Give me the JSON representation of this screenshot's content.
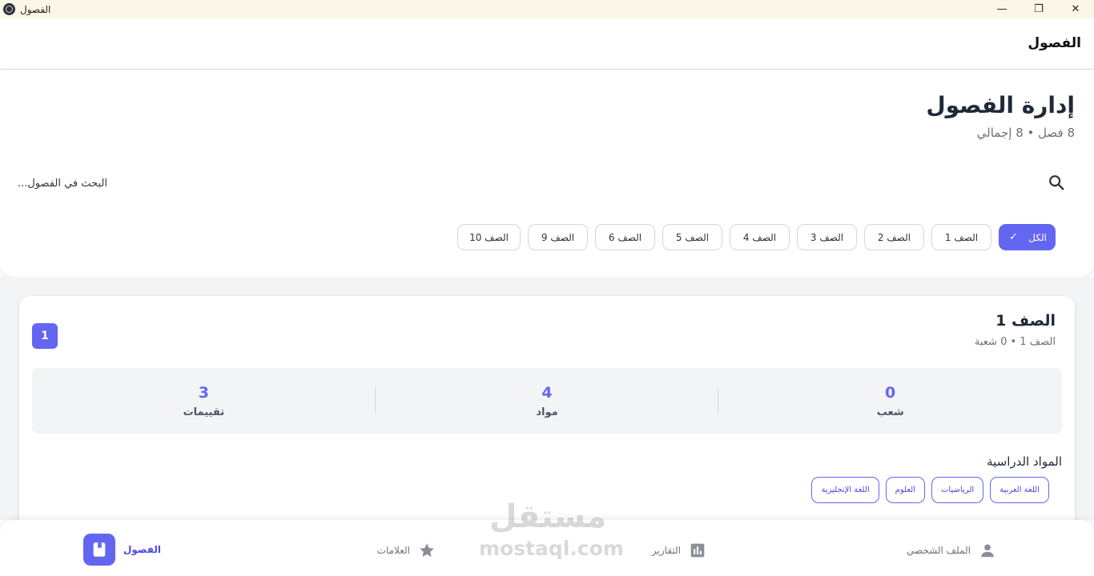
{
  "window": {
    "title": "الفصول",
    "controls": {
      "minimize": "—",
      "restore": "❐",
      "close": "✕"
    }
  },
  "appbar": {
    "title": "الفصول"
  },
  "header": {
    "title": "إدارة الفصول",
    "subtitle": "8 فصل • 8 إجمالي"
  },
  "search": {
    "placeholder": "البحث في الفصول..."
  },
  "filters": {
    "all": {
      "label": "الكل",
      "check": "✓"
    },
    "grades": [
      {
        "label": "الصف 1"
      },
      {
        "label": "الصف 2"
      },
      {
        "label": "الصف 3"
      },
      {
        "label": "الصف 4"
      },
      {
        "label": "الصف 5"
      },
      {
        "label": "الصف 6"
      },
      {
        "label": "الصف 9"
      },
      {
        "label": "الصف 10"
      }
    ]
  },
  "grade_card": {
    "title": "الصف 1",
    "subtitle": "الصف 1 • 0 شعبة",
    "badge": "1",
    "stats": [
      {
        "value": "0",
        "label": "شعب"
      },
      {
        "value": "4",
        "label": "مواد"
      },
      {
        "value": "3",
        "label": "تقييمات"
      }
    ],
    "subjects_title": "المواد الدراسية",
    "subjects": [
      {
        "label": "اللغة العربية"
      },
      {
        "label": "الرياضيات"
      },
      {
        "label": "العلوم"
      },
      {
        "label": "اللغة الإنجليزية"
      }
    ]
  },
  "watermark": {
    "arabic": "مستقل",
    "latin": "mostaql.com"
  },
  "bottom_nav": {
    "items": [
      {
        "label": "الملف الشخصي",
        "icon": "person-icon"
      },
      {
        "label": "التقارير",
        "icon": "bar-chart-icon"
      },
      {
        "label": "العلامات",
        "icon": "star-icon"
      },
      {
        "label": "الفصول",
        "icon": "book-icon",
        "active": true
      }
    ]
  },
  "colors": {
    "accent": "#6366f1",
    "titlebar_bg": "#fbf6e7",
    "content_bg": "#f3f4f6"
  }
}
